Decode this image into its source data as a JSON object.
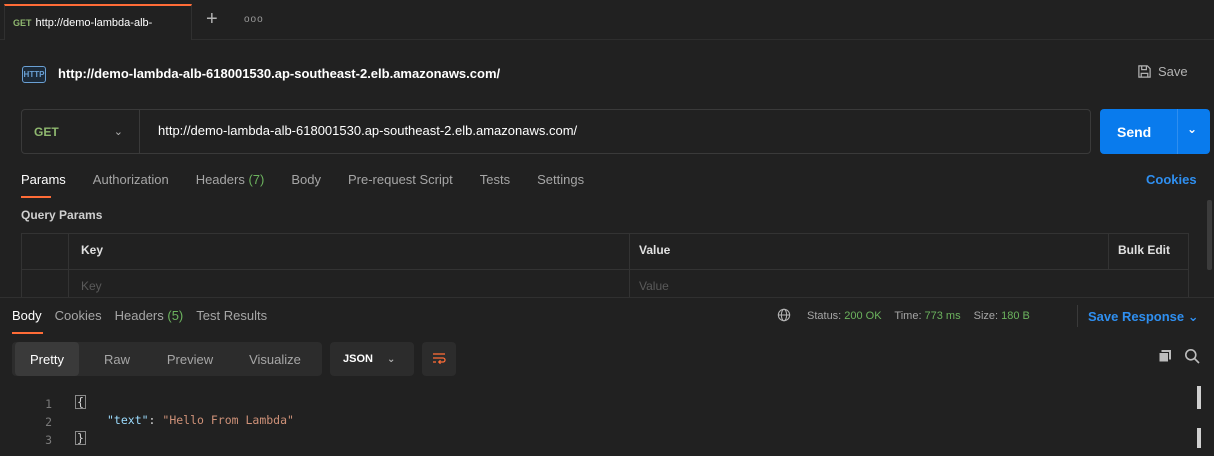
{
  "tab": {
    "method": "GET",
    "title": "http://demo-lambda-alb-"
  },
  "request": {
    "icon_text": "HTTP",
    "title": "http://demo-lambda-alb-618001530.ap-southeast-2.elb.amazonaws.com/",
    "save_label": "Save",
    "method": "GET",
    "url": "http://demo-lambda-alb-618001530.ap-southeast-2.elb.amazonaws.com/",
    "send_label": "Send"
  },
  "request_tabs": {
    "params": "Params",
    "authorization": "Authorization",
    "headers": "Headers",
    "headers_count": "(7)",
    "body": "Body",
    "prerequest": "Pre-request Script",
    "tests": "Tests",
    "settings": "Settings",
    "cookies": "Cookies"
  },
  "query_params": {
    "title": "Query Params",
    "col_key": "Key",
    "col_value": "Value",
    "bulk_edit": "Bulk Edit",
    "key_placeholder": "Key",
    "value_placeholder": "Value"
  },
  "response": {
    "tabs": {
      "body": "Body",
      "cookies": "Cookies",
      "headers": "Headers",
      "headers_count": "(5)",
      "test_results": "Test Results"
    },
    "status_label": "Status:",
    "status_value": "200 OK",
    "time_label": "Time:",
    "time_value": "773 ms",
    "size_label": "Size:",
    "size_value": "180 B",
    "save_response": "Save Response",
    "views": {
      "pretty": "Pretty",
      "raw": "Raw",
      "preview": "Preview",
      "visualize": "Visualize"
    },
    "format": "JSON",
    "code_lines": [
      {
        "num": "1",
        "text": "{"
      },
      {
        "num": "2",
        "key": "\"text\"",
        "colon": ": ",
        "value": "\"Hello From Lambda\""
      },
      {
        "num": "3",
        "text": "}"
      }
    ]
  },
  "colors": {
    "accent_orange": "#ff6c37",
    "primary_blue": "#097bed",
    "success_green": "#6cb35e",
    "method_green": "#8fb86f"
  }
}
